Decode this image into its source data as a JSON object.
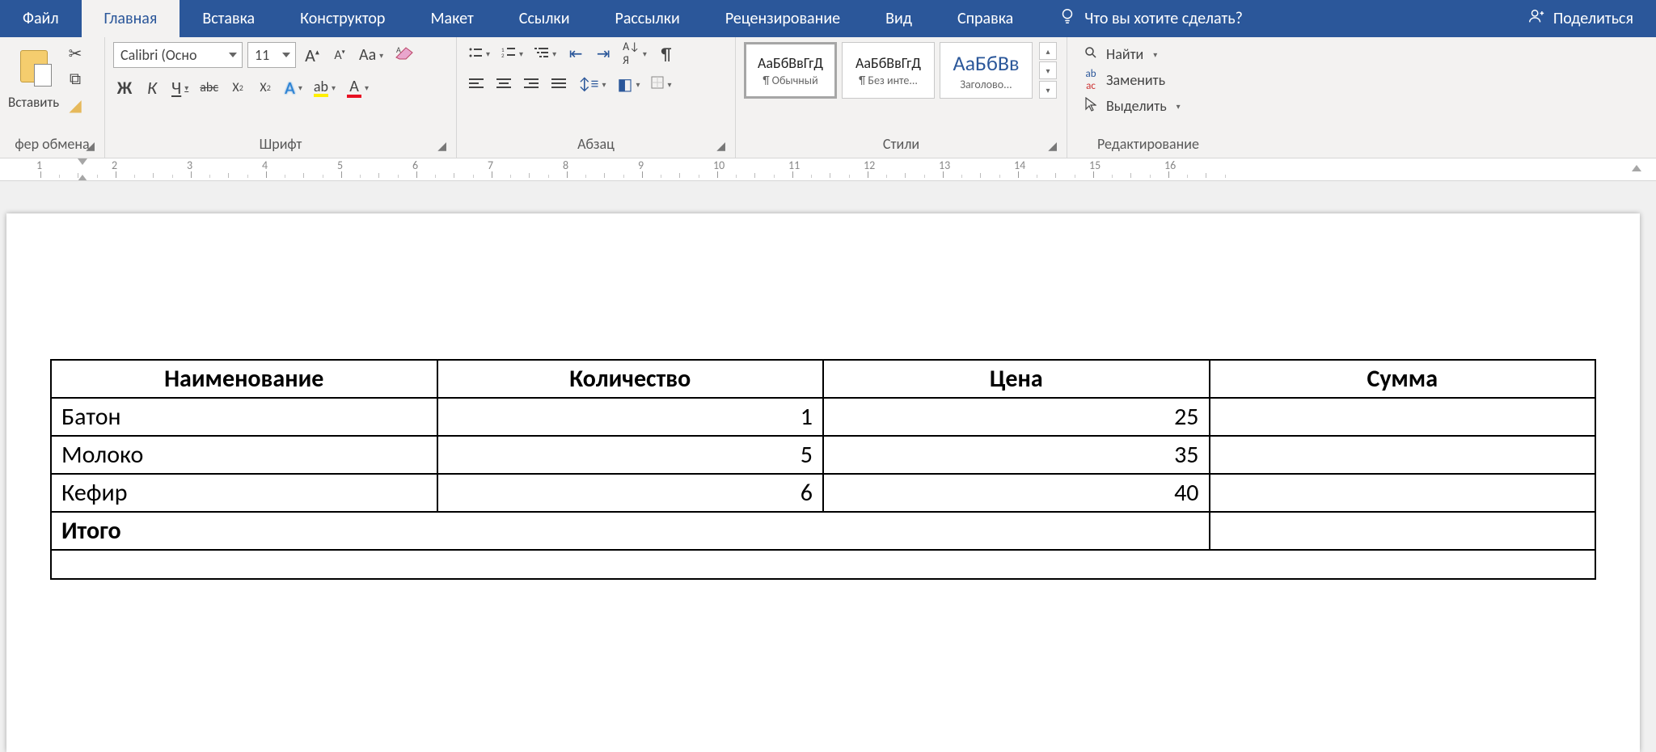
{
  "tabs": {
    "file": "Файл",
    "home": "Главная",
    "insert": "Вставка",
    "design": "Конструктор",
    "layout": "Макет",
    "references": "Ссылки",
    "mailings": "Рассылки",
    "review": "Рецензирование",
    "view": "Вид",
    "help": "Справка",
    "tellme": "Что вы хотите сделать?",
    "share": "Поделиться"
  },
  "ribbon": {
    "clipboard": {
      "paste": "Вставить",
      "label": "фер обмена"
    },
    "font": {
      "name": "Calibri (Осно",
      "size": "11",
      "bold": "Ж",
      "italic": "К",
      "underline": "Ч",
      "strike": "abc",
      "sub": "X",
      "sup": "X",
      "Aa": "Aa",
      "label": "Шрифт"
    },
    "paragraph": {
      "label": "Абзац"
    },
    "styles": {
      "s1_preview": "АаБбВвГгД",
      "s1_name": "¶ Обычный",
      "s2_preview": "АаБбВвГгД",
      "s2_name": "¶ Без инте...",
      "s3_preview": "АаБбВв",
      "s3_name": "Заголово...",
      "label": "Стили"
    },
    "editing": {
      "find": "Найти",
      "replace": "Заменить",
      "select": "Выделить",
      "label": "Редактирование"
    }
  },
  "ruler": {
    "marks": [
      "1",
      "2",
      "3",
      "4",
      "5",
      "6",
      "7",
      "8",
      "9",
      "10",
      "11",
      "12",
      "13",
      "14",
      "15",
      "16"
    ]
  },
  "table": {
    "headers": [
      "Наименование",
      "Количество",
      "Цена",
      "Сумма"
    ],
    "rows": [
      {
        "name": "Батон",
        "qty": "1",
        "price": "25",
        "sum": ""
      },
      {
        "name": "Молоко",
        "qty": "5",
        "price": "35",
        "sum": ""
      },
      {
        "name": "Кефир",
        "qty": "6",
        "price": "40",
        "sum": ""
      }
    ],
    "total_label": "Итого"
  }
}
